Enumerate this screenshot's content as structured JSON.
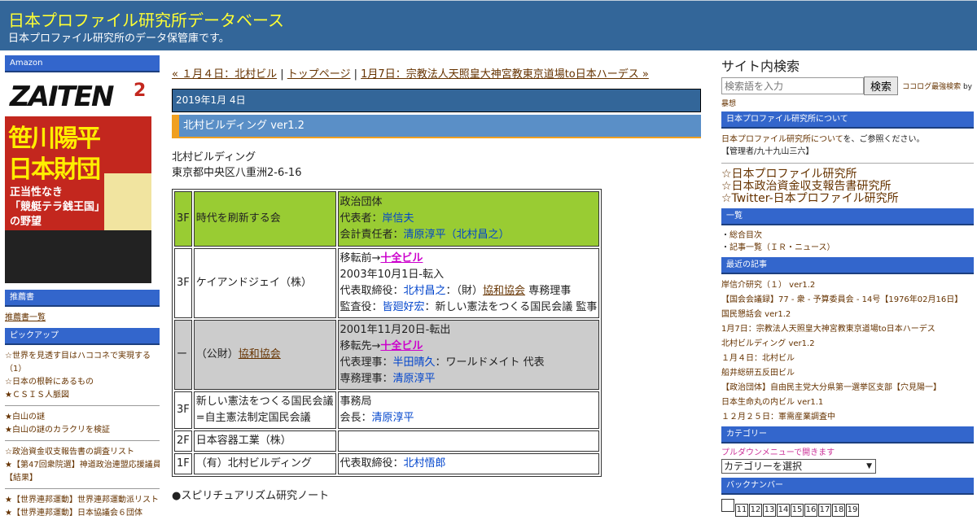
{
  "header": {
    "title": "日本プロファイル研究所データベース",
    "description": "日本プロファイル研究所のデータ保管庫です。"
  },
  "left": {
    "amazon_heading": "Amazon",
    "cover": {
      "month": "2",
      "logo": "ZAITEN",
      "headline_1": "笹川陽平",
      "headline_2": "日本財団",
      "sub_1": "正当性なき",
      "sub_2": "「競艇テラ銭王国」",
      "sub_3": "の野望"
    },
    "recommend_heading": "推薦書",
    "recommend_link": "推薦書一覧",
    "pickup_heading": "ピックアップ",
    "pickup_group1": [
      "☆世界を見透す目はハココネで実現する",
      "（1）",
      "☆日本の根幹にあるもの",
      "★ＣＳＩＳ人脈図"
    ],
    "pickup_group2": [
      "★白山の謎",
      "★白山の謎のカラクリを検証"
    ],
    "pickup_group3": [
      "☆政治資金収支報告書の調査リスト",
      "★【第47回衆院選】神道政治連盟応援議員",
      "【結果】"
    ],
    "pickup_group4": [
      "★【世界連邦運動】世界連邦運動派リスト",
      "★【世界連邦運動】日本協議会６団体"
    ]
  },
  "main": {
    "nav": {
      "prev": "« １月４日：北村ビル",
      "sep1": " | ",
      "top": "トップページ",
      "sep2": " | ",
      "next": "1月7日：宗教法人天照皇大神宮教東京道場to日本ハーデス »"
    },
    "date": "2019年1月 4日",
    "post_title": "北村ビルディング ver1.2",
    "intro": [
      "北村ビルディング",
      "東京都中央区八重洲2-6-16"
    ],
    "table": {
      "r1": {
        "floor": "3F",
        "name": "時代を刷新する会",
        "l1": "政治団体",
        "l2_label": "代表者：",
        "l2_val": "岸信夫",
        "l3_label": "会計責任者：",
        "l3_val": "清原淳平",
        "l3_open": "（",
        "l3_val2": "北村昌之",
        "l3_close": "）"
      },
      "r2": {
        "floor": "3F",
        "name": "ケイアンドジェイ（株）",
        "l1_label": "移転前→",
        "l1_val": "十全ビル",
        "l2": "2003年10月1日-転入",
        "l3_label": "代表取締役：",
        "l3_val": "北村昌之",
        "l3_mid": "：（財）",
        "l3_val2": "協和協会",
        "l3_tail": " 専務理事",
        "l4_label": "監査役：",
        "l4_val": "皆廻好宏",
        "l4_tail": "：新しい憲法をつくる国民会議 監事"
      },
      "r3": {
        "floor": "ー",
        "name_pre": "（公財）",
        "name_link": "協和協会",
        "l1": "2001年11月20日-転出",
        "l2_label": "移転先→",
        "l2_val": "十全ビル",
        "l3_label": "代表理事：",
        "l3_val": "半田晴久",
        "l3_tail": "：ワールドメイト 代表",
        "l4_label": "専務理事：",
        "l4_val": "清原淳平"
      },
      "r4": {
        "floor": "3F",
        "name_1": "新しい憲法をつくる国民会議",
        "name_2": "=自主憲法制定国民会議",
        "l1": "事務局",
        "l2_label": "会長：",
        "l2_val": "清原淳平"
      },
      "r5": {
        "floor": "2F",
        "name": "日本容器工業（株）"
      },
      "r6": {
        "floor": "1F",
        "name": "（有）北村ビルディング",
        "l1_label": "代表取締役：",
        "l1_val": "北村悟郎"
      }
    },
    "spirit": "●スピリチュアリズム研究ノート"
  },
  "right": {
    "search_label": "サイト内検索",
    "search_placeholder": "検索語を入力",
    "search_button": "検索",
    "search_powered_1": "ココログ最強検索",
    "search_powered_2": " by",
    "search_powered_3": "暴想",
    "about_heading": "日本プロファイル研究所について",
    "about_link": "日本プロファイル研究所について",
    "about_tail": "を、ご参照ください。",
    "manager": "【管理者/九十九山三六】",
    "big_links": [
      "☆日本プロファイル研究所",
      "☆日本政治資金収支報告書研究所",
      "☆Twitter-日本プロファイル研究所"
    ],
    "list_heading": "一覧",
    "list_items": [
      {
        "bullet": "・",
        "label": "総合目次"
      },
      {
        "bullet": "・",
        "label": "記事一覧（ＩＲ・ニュース）"
      }
    ],
    "recent_heading": "最近の記事",
    "recent": [
      "岸信介研究（１） ver1.2",
      "【国会会議録】77 - 衆 - 予算委員会 - 14号【1976年02月16日】",
      "国民懇話会 ver1.2",
      "1月7日：宗教法人天照皇大神宮教東京道場to日本ハーデス",
      "北村ビルディング ver1.2",
      "１月４日：北村ビル",
      "船井総研五反田ビル",
      "【政治団体】自由民主党大分県第一選挙区支部【穴見陽一】",
      "日本生命丸の内ビル ver1.1",
      "１２月２５日：軍需産業調査中"
    ],
    "category_heading": "カテゴリー",
    "category_note": "プルダウンメニューで開きます",
    "category_select": "カテゴリーを選択",
    "backnumber_heading": "バックナンバー",
    "backnumbers": [
      "",
      "11",
      "12",
      "13",
      "14",
      "15",
      "16",
      "17",
      "18",
      "19"
    ]
  }
}
